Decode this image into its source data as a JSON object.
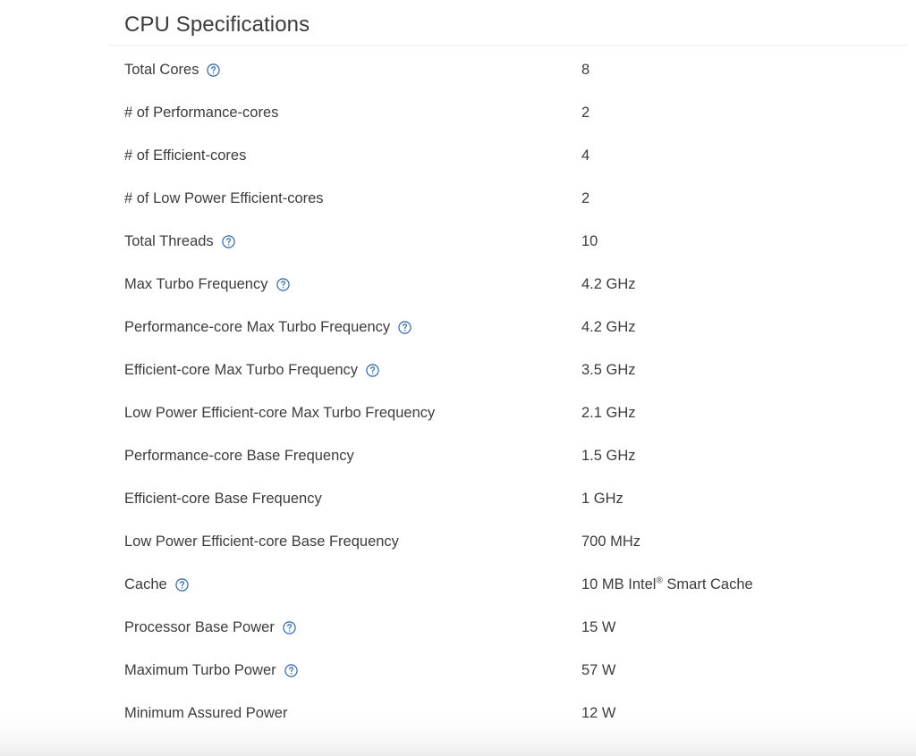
{
  "page": {
    "background_color": "#ffffff",
    "text_color": "#3c3c3c",
    "accent_color": "#3b6ea5",
    "divider_color": "#ececec"
  },
  "section": {
    "title": "CPU Specifications"
  },
  "icons": {
    "help": "help-circle-icon"
  },
  "specs": [
    {
      "label": "Total Cores",
      "value": "8",
      "has_help": true
    },
    {
      "label": "# of Performance-cores",
      "value": "2",
      "has_help": false
    },
    {
      "label": "# of Efficient-cores",
      "value": "4",
      "has_help": false
    },
    {
      "label": "# of Low Power Efficient-cores",
      "value": "2",
      "has_help": false
    },
    {
      "label": "Total Threads",
      "value": "10",
      "has_help": true
    },
    {
      "label": "Max Turbo Frequency",
      "value": "4.2 GHz",
      "has_help": true
    },
    {
      "label": "Performance-core Max Turbo Frequency",
      "value": "4.2 GHz",
      "has_help": true
    },
    {
      "label": "Efficient-core Max Turbo Frequency",
      "value": "3.5 GHz",
      "has_help": true
    },
    {
      "label": "Low Power Efficient-core Max Turbo Frequency",
      "value": "2.1 GHz",
      "has_help": false
    },
    {
      "label": "Performance-core Base Frequency",
      "value": "1.5 GHz",
      "has_help": false
    },
    {
      "label": "Efficient-core Base Frequency",
      "value": "1 GHz",
      "has_help": false
    },
    {
      "label": "Low Power Efficient-core Base Frequency",
      "value": "700 MHz",
      "has_help": false
    },
    {
      "label": "Cache",
      "value": "10 MB Intel® Smart Cache",
      "has_help": true
    },
    {
      "label": "Processor Base Power",
      "value": "15 W",
      "has_help": true
    },
    {
      "label": "Maximum Turbo Power",
      "value": "57 W",
      "has_help": true
    },
    {
      "label": "Minimum Assured Power",
      "value": "12 W",
      "has_help": false
    }
  ]
}
